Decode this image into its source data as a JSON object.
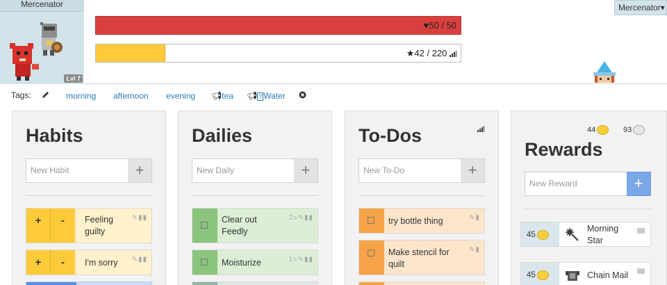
{
  "header": {
    "avatar_name": "Mercenator",
    "level": "Lvl 7",
    "party_member": "Mercenator",
    "party_caret": "▾",
    "hp_text": "♥50 / 50",
    "hp_value": 50,
    "hp_max": 50,
    "xp_text": "★42 / 220",
    "xp_value": 42,
    "xp_max": 220
  },
  "tags": {
    "label": "Tags:",
    "items": [
      "morning",
      "afternoon",
      "evening",
      "tea",
      "Water"
    ]
  },
  "habits": {
    "title": "Habits",
    "placeholder": "New Habit",
    "items": [
      {
        "text": "Feeling guilty"
      },
      {
        "text": "I'm sorry"
      }
    ]
  },
  "dailies": {
    "title": "Dailies",
    "placeholder": "New Daily",
    "items": [
      {
        "text": "Clear out Feedly",
        "streak": "2"
      },
      {
        "text": "Moisturize",
        "streak": "1"
      }
    ]
  },
  "todos": {
    "title": "To-Dos",
    "placeholder": "New To-Do",
    "items": [
      {
        "text": "try bottle thing"
      },
      {
        "text": "Make stencil for quilt"
      }
    ]
  },
  "rewards": {
    "title": "Rewards",
    "placeholder": "New Reward",
    "gold": "44",
    "silver": "93",
    "items": [
      {
        "cost": "45",
        "name": "Morning Star"
      },
      {
        "cost": "45",
        "name": "Chain Mail"
      }
    ]
  },
  "colors": {
    "hp": "#d9403d",
    "xp": "#fdca3a",
    "habit": "#fdca3a",
    "daily": "#8bc47d",
    "todo": "#f5a346",
    "link": "#2a7bb6",
    "reward_add": "#7aa7e8"
  }
}
